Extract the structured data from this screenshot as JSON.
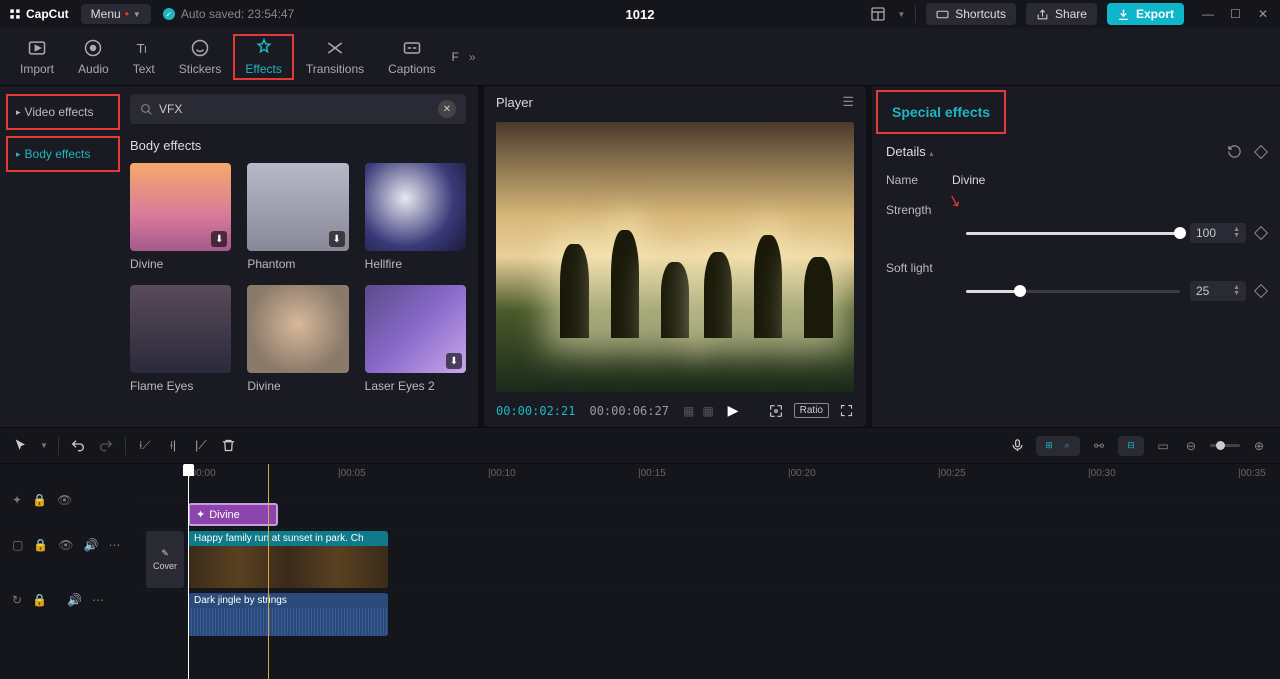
{
  "titlebar": {
    "brand": "CapCut",
    "menu": "Menu",
    "autosave": "Auto saved: 23:54:47",
    "project_title": "1012",
    "shortcuts": "Shortcuts",
    "share": "Share",
    "export": "Export"
  },
  "toolbar": {
    "tabs": [
      "Import",
      "Audio",
      "Text",
      "Stickers",
      "Effects",
      "Transitions",
      "Captions",
      "F"
    ],
    "active_index": 4
  },
  "left_sidebar": {
    "items": [
      {
        "label": "Video effects",
        "active": false
      },
      {
        "label": "Body effects",
        "active": true
      }
    ]
  },
  "effects": {
    "search_value": "VFX",
    "section_title": "Body effects",
    "cards": [
      {
        "label": "Divine"
      },
      {
        "label": "Phantom"
      },
      {
        "label": "Hellfire"
      },
      {
        "label": "Flame Eyes"
      },
      {
        "label": "Divine"
      },
      {
        "label": "Laser Eyes 2"
      }
    ]
  },
  "player": {
    "title": "Player",
    "current_time": "00:00:02:21",
    "total_time": "00:00:06:27",
    "ratio_label": "Ratio"
  },
  "right_panel": {
    "tab": "Special effects",
    "details_label": "Details",
    "name_label": "Name",
    "name_value": "Divine",
    "sliders": [
      {
        "label": "Strength",
        "value": 100,
        "percent": 100
      },
      {
        "label": "Soft light",
        "value": 25,
        "percent": 25
      }
    ]
  },
  "timeline": {
    "ruler": [
      "00:00",
      "00:05",
      "00:10",
      "00:15",
      "00:20",
      "00:25",
      "00:30",
      "00:35"
    ],
    "cover_label": "Cover",
    "clips": {
      "effect": "Divine",
      "video": "Happy family run at sunset in park. Ch",
      "audio": "Dark jingle by strings"
    }
  }
}
